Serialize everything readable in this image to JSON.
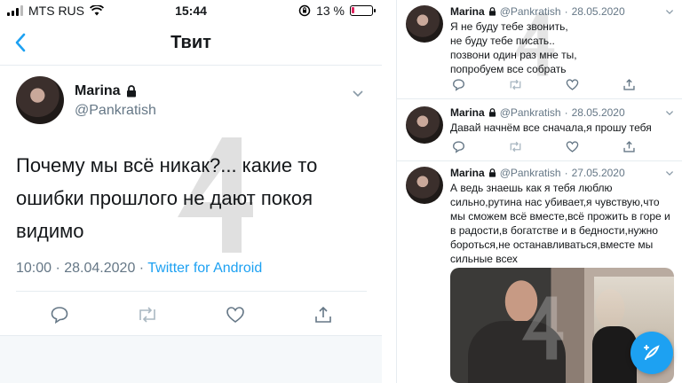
{
  "left": {
    "status": {
      "carrier": "MTS RUS",
      "time": "15:44",
      "battery": "13 %",
      "battery_level": 0.13
    },
    "nav": {
      "title": "Твит"
    },
    "tweet": {
      "name": "Marina",
      "handle": "@Pankratish",
      "text": "Почему мы всё никак?... какие то ошибки прошлого не дают покоя видимо",
      "time_date": "10:00 · 28.04.2020 · ",
      "source": "Twitter for Android"
    }
  },
  "right": {
    "tweets": [
      {
        "name": "Marina",
        "handle": "@Pankratish",
        "date": "28.05.2020",
        "text": "Я не буду тебе звонить,\nне буду тебе писать..\nпозвони один раз мне ты,\nпопробуем все собрать"
      },
      {
        "name": "Marina",
        "handle": "@Pankratish",
        "date": "28.05.2020",
        "text": "Давай начнём все сначала,я прошу тебя"
      },
      {
        "name": "Marina",
        "handle": "@Pankratish",
        "date": "27.05.2020",
        "text": "А ведь знаешь как я тебя люблю сильно,рутина нас убивает,я чувствую,что мы сможем всё вместе,всё прожить в горе и в радости,в богатстве и в бедности,нужно бороться,не останавливаться,вместе мы сильные всех"
      }
    ]
  },
  "icons": {
    "lock": "lock-icon",
    "chevron": "chevron-down-icon",
    "reply": "reply-icon",
    "retweet": "retweet-icon",
    "like": "heart-icon",
    "share": "share-icon",
    "compose": "compose-icon"
  },
  "colors": {
    "accent": "#1da1f2",
    "text": "#14171a",
    "muted": "#657786",
    "battery_low": "#e0245e"
  }
}
